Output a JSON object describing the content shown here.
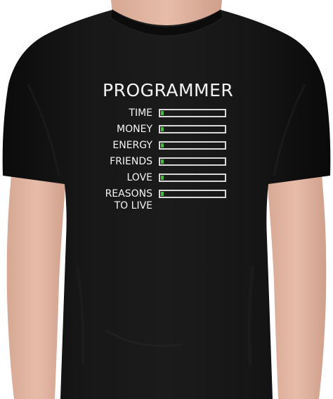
{
  "shirt_print": {
    "title": "PROGRAMMER",
    "meters": [
      {
        "label": "TIME",
        "fill_fraction": 0.04
      },
      {
        "label": "MONEY",
        "fill_fraction": 0.04
      },
      {
        "label": "ENERGY",
        "fill_fraction": 0.04
      },
      {
        "label": "FRIENDS",
        "fill_fraction": 0.04
      },
      {
        "label": "LOVE",
        "fill_fraction": 0.04
      },
      {
        "label": "REASONS\nTO LIVE",
        "fill_fraction": 0.04
      }
    ]
  },
  "colors": {
    "shirt": "#111111",
    "text": "#f4f4f4",
    "bar_outline": "#d9d9d9",
    "bar_fill": "#46b83f"
  }
}
